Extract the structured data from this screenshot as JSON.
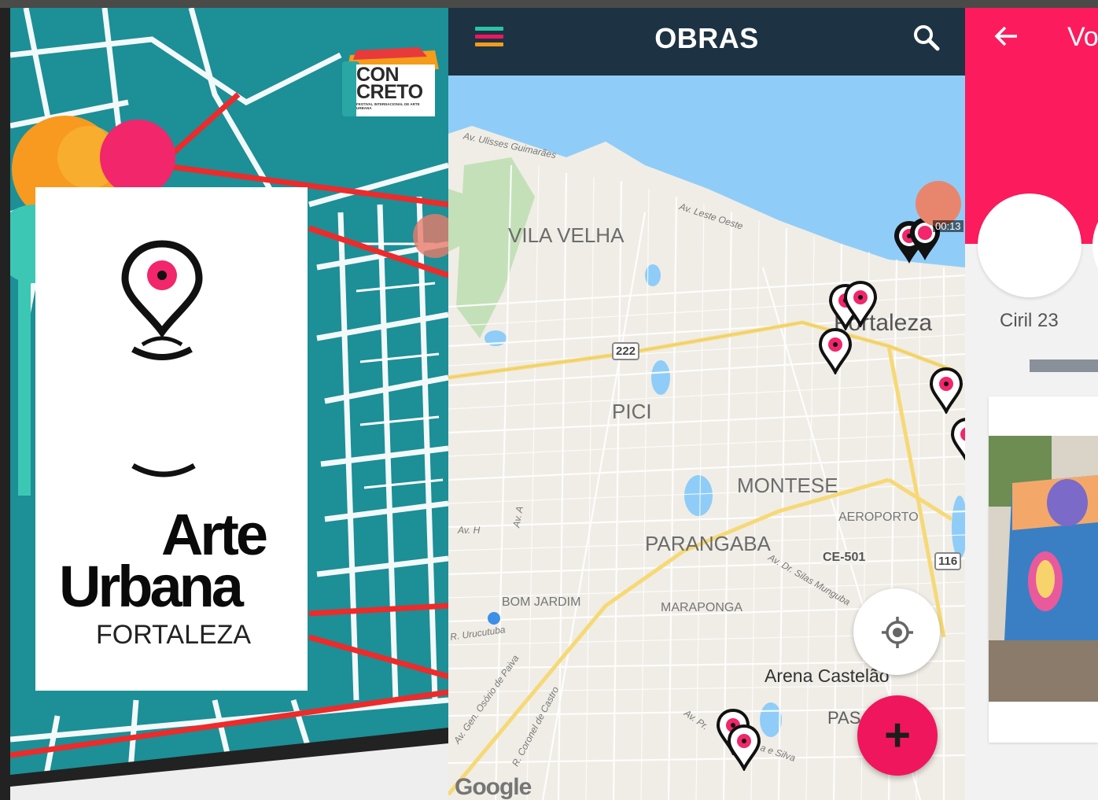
{
  "splash": {
    "brand_line1": "CON",
    "brand_line2": "CRETO",
    "brand_sub": "FESTIVAL INTERNACIONAL DE ARTE URBANA",
    "title_line1": "Arte",
    "title_line2": "Urbana",
    "city": "FORTALEZA"
  },
  "map_screen": {
    "title": "OBRAS",
    "neighborhoods": [
      "VILA VELHA",
      "PICI",
      "MONTESE",
      "PARANGABA",
      "BOM JARDIM",
      "MARAPONGA",
      "AEROPORTO"
    ],
    "city_label": "Fortaleza",
    "venue_label": "Arena Castelão",
    "partial_label": "PAS",
    "streets": [
      "Av. Ulisses Guimarães",
      "Av. Leste Oeste",
      "Av. H",
      "Av. A",
      "R. Urucutuba",
      "Av. Gen. Osório de Paiva",
      "R. Coronel de Castro",
      "Av. Dr. Silas Munguba",
      "Av. Pr.",
      "a e Silva"
    ],
    "route_shields": [
      "222",
      "116"
    ],
    "route_labels": [
      "CE-501"
    ],
    "marker_time": "00:13",
    "attribution": "Google",
    "colors": {
      "appbar": "#1d3344",
      "accent": "#f0165d",
      "water": "#8fcdf8",
      "park": "#c4e0b8"
    }
  },
  "profile_screen": {
    "title_partial": "Vo",
    "username": "Ciril 23",
    "colors": {
      "header": "#fc1c5d"
    }
  },
  "icons": {
    "menu": "hamburger-icon",
    "search": "search-icon",
    "locate": "my-location-icon",
    "add": "plus-icon",
    "back": "arrow-back-icon",
    "marker": "map-marker-icon"
  }
}
